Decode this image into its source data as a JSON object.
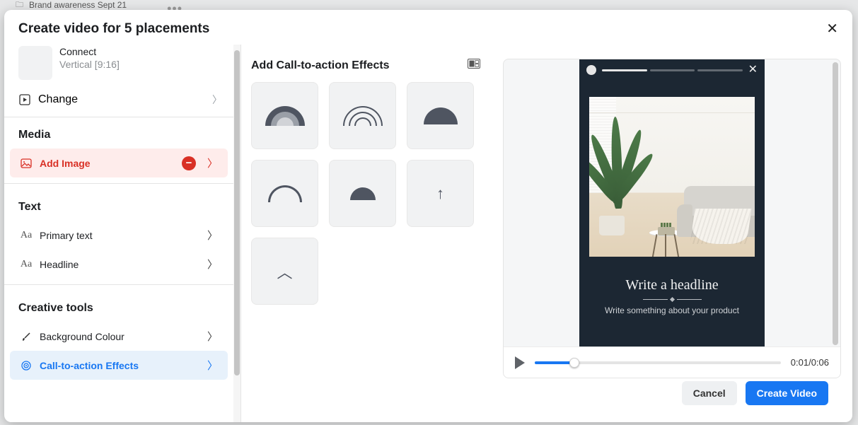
{
  "background": {
    "tab_label": "Brand awareness Sept 21"
  },
  "modal": {
    "title": "Create video for 5 placements",
    "cancel": "Cancel",
    "submit": "Create Video"
  },
  "template": {
    "name": "Connect",
    "aspect": "Vertical [9:16]",
    "change": "Change"
  },
  "sections": {
    "media": "Media",
    "text": "Text",
    "tools": "Creative tools"
  },
  "items": {
    "add_image": "Add Image",
    "primary_text": "Primary text",
    "headline": "Headline",
    "bg_colour": "Background Colour",
    "cta_fx": "Call-to-action Effects"
  },
  "center": {
    "title": "Add Call-to-action Effects"
  },
  "preview": {
    "headline": "Write a headline",
    "subtext": "Write something about your product",
    "time": "0:01/0:06"
  }
}
